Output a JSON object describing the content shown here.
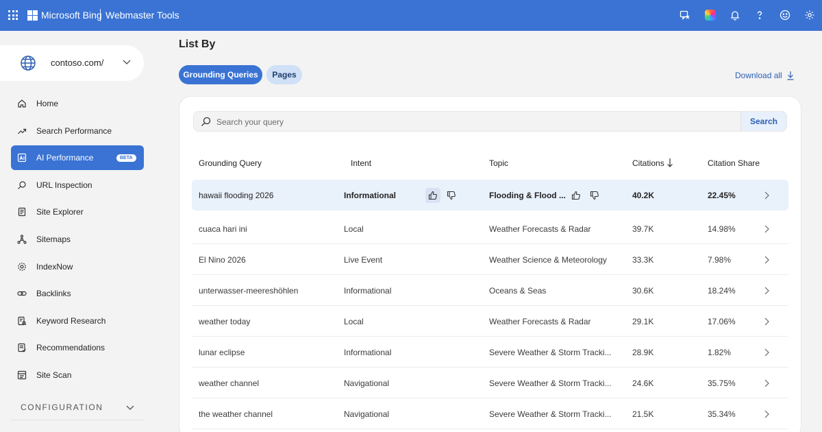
{
  "topbar": {
    "brand": "Microsoft Bing",
    "product": "Webmaster Tools",
    "icons": [
      "apps-icon",
      "feedback-icon",
      "copilot-icon",
      "notifications-icon",
      "help-icon",
      "smiley-icon",
      "settings-icon"
    ]
  },
  "site": {
    "name": "contoso.com/"
  },
  "sidebar": {
    "items": [
      {
        "label": "Home",
        "icon": "home-icon"
      },
      {
        "label": "Search Performance",
        "icon": "trend-icon"
      },
      {
        "label": "AI Performance",
        "icon": "ai-icon",
        "badge": "BETA",
        "active": true
      },
      {
        "label": "URL Inspection",
        "icon": "search-icon"
      },
      {
        "label": "Site Explorer",
        "icon": "document-icon"
      },
      {
        "label": "Sitemaps",
        "icon": "sitemap-icon"
      },
      {
        "label": "IndexNow",
        "icon": "gear-icon"
      },
      {
        "label": "Backlinks",
        "icon": "link-icon"
      },
      {
        "label": "Keyword Research",
        "icon": "keyword-icon"
      },
      {
        "label": "Recommendations",
        "icon": "recommendations-icon"
      },
      {
        "label": "Site Scan",
        "icon": "scan-icon"
      }
    ],
    "config_label": "CONFIGURATION"
  },
  "main": {
    "list_by": "List By",
    "tabs": [
      {
        "label": "Grounding Queries",
        "active": true
      },
      {
        "label": "Pages",
        "active": false
      }
    ],
    "download_label": "Download all",
    "search": {
      "placeholder": "Search your query",
      "value": "",
      "button": "Search"
    },
    "table": {
      "headers": [
        "Grounding Query",
        "Intent",
        "Topic",
        "Citations",
        "Citation Share"
      ],
      "rows": [
        {
          "query": "hawaii flooding 2026",
          "intent": "Informational",
          "topic": "Flooding & Flood ...",
          "citations": "40.2K",
          "share": "22.45%"
        },
        {
          "query": "cuaca hari ini",
          "intent": "Local",
          "topic": "Weather Forecasts & Radar",
          "citations": "39.7K",
          "share": "14.98%"
        },
        {
          "query": "El Nino 2026",
          "intent": "Live Event",
          "topic": "Weather Science & Meteorology",
          "citations": "33.3K",
          "share": "7.98%"
        },
        {
          "query": "unterwasser-meereshöhlen",
          "intent": "Informational",
          "topic": "Oceans & Seas",
          "citations": "30.6K",
          "share": "18.24%"
        },
        {
          "query": "weather today",
          "intent": "Local",
          "topic": "Weather Forecasts & Radar",
          "citations": "29.1K",
          "share": "17.06%"
        },
        {
          "query": "lunar eclipse",
          "intent": "Informational",
          "topic": "Severe Weather & Storm Tracki...",
          "citations": "28.9K",
          "share": "1.82%"
        },
        {
          "query": "weather channel",
          "intent": "Navigational",
          "topic": "Severe Weather & Storm Tracki...",
          "citations": "24.6K",
          "share": "35.75%"
        },
        {
          "query": "the weather channel",
          "intent": "Navigational",
          "topic": "Severe Weather & Storm Tracki...",
          "citations": "21.5K",
          "share": "35.34%"
        }
      ]
    }
  },
  "colors": {
    "accent": "#3a73d4",
    "pill_inactive": "#cfe0f7",
    "row_highlight": "#e9f1fb"
  }
}
